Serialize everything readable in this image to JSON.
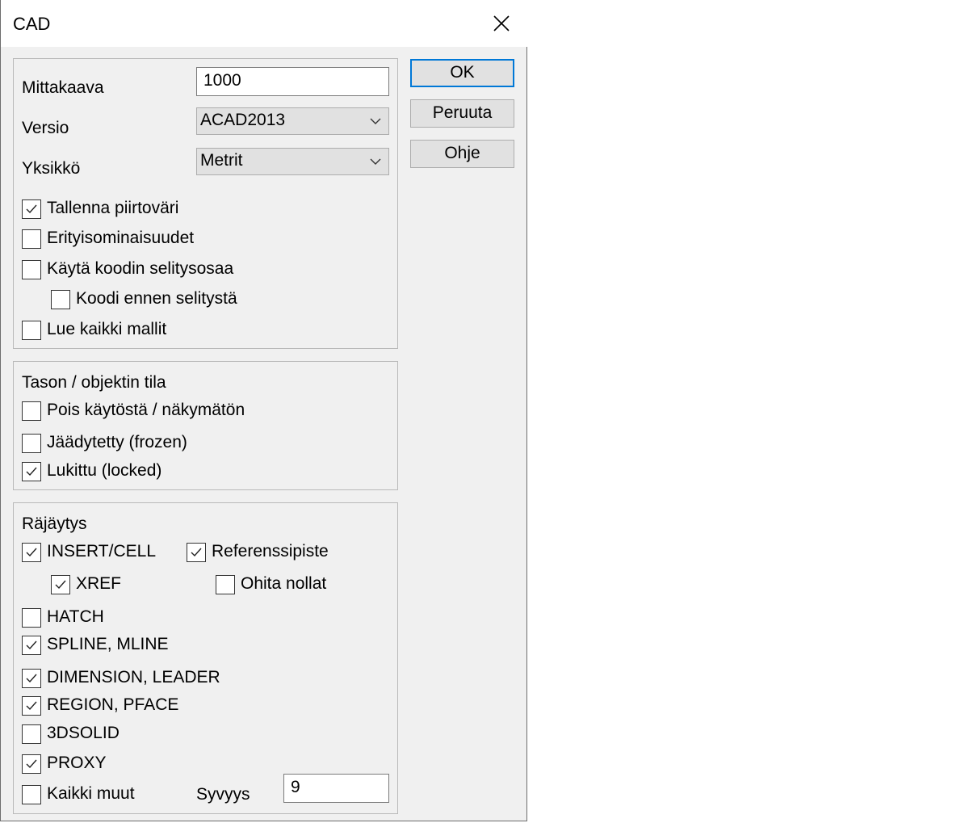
{
  "window": {
    "title": "CAD"
  },
  "buttons": {
    "ok": "OK",
    "cancel": "Peruuta",
    "help": "Ohje"
  },
  "general": {
    "scale_label": "Mittakaava",
    "scale_value": "1000",
    "version_label": "Versio",
    "version_value": "ACAD2013",
    "unit_label": "Yksikkö",
    "unit_value": "Metrit",
    "save_color": {
      "label": "Tallenna piirtoväri",
      "checked": true
    },
    "special_props": {
      "label": "Erityisominaisuudet",
      "checked": false
    },
    "use_code_desc": {
      "label": "Käytä koodin selitysosaa",
      "checked": false
    },
    "code_before_desc": {
      "label": "Koodi ennen selitystä",
      "checked": false
    },
    "read_all_models": {
      "label": "Lue kaikki mallit",
      "checked": false
    }
  },
  "layer_state": {
    "heading": "Tason / objektin tila",
    "off_invisible": {
      "label": "Pois käytöstä / näkymätön",
      "checked": false
    },
    "frozen": {
      "label": "Jäädytetty (frozen)",
      "checked": false
    },
    "locked": {
      "label": "Lukittu (locked)",
      "checked": true
    }
  },
  "explode": {
    "heading": "Räjäytys",
    "insert_cell": {
      "label": "INSERT/CELL",
      "checked": true
    },
    "reference_point": {
      "label": "Referenssipiste",
      "checked": true
    },
    "xref": {
      "label": "XREF",
      "checked": true
    },
    "skip_zeros": {
      "label": "Ohita nollat",
      "checked": false
    },
    "hatch": {
      "label": "HATCH",
      "checked": false
    },
    "spline_mline": {
      "label": "SPLINE, MLINE",
      "checked": true
    },
    "dimension_leader": {
      "label": "DIMENSION, LEADER",
      "checked": true
    },
    "region_pface": {
      "label": "REGION, PFACE",
      "checked": true
    },
    "solid3d": {
      "label": "3DSOLID",
      "checked": false
    },
    "proxy": {
      "label": "PROXY",
      "checked": true
    },
    "all_others": {
      "label": "Kaikki muut",
      "checked": false
    },
    "depth_label": "Syvyys",
    "depth_value": "9"
  }
}
